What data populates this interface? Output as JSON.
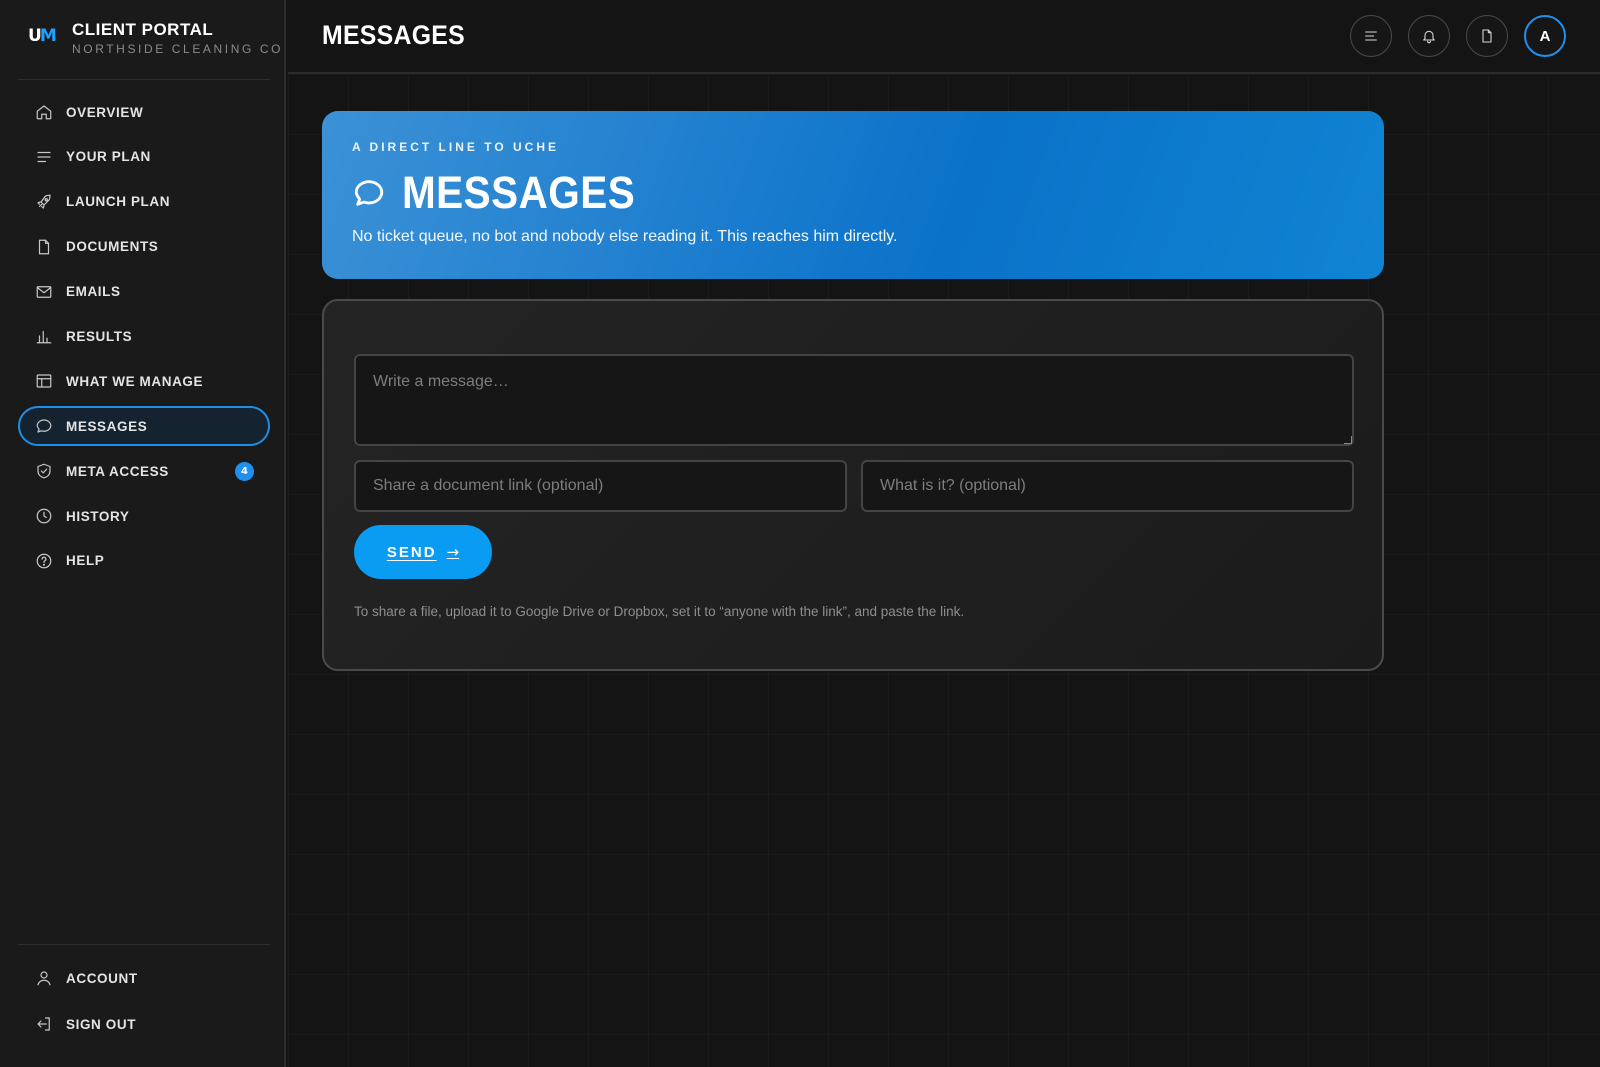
{
  "brand": {
    "logo_text": "UM",
    "title": "CLIENT PORTAL",
    "subtitle": "NORTHSIDE CLEANING CO"
  },
  "sidebar": {
    "items": [
      {
        "label": "OVERVIEW",
        "icon": "home-icon"
      },
      {
        "label": "YOUR PLAN",
        "icon": "list-icon"
      },
      {
        "label": "LAUNCH PLAN",
        "icon": "rocket-icon"
      },
      {
        "label": "DOCUMENTS",
        "icon": "document-icon"
      },
      {
        "label": "EMAILS",
        "icon": "mail-icon"
      },
      {
        "label": "RESULTS",
        "icon": "bar-chart-icon"
      },
      {
        "label": "WHAT WE MANAGE",
        "icon": "layout-icon"
      },
      {
        "label": "MESSAGES",
        "icon": "chat-icon",
        "active": true
      },
      {
        "label": "META ACCESS",
        "icon": "shield-icon",
        "badge": "4"
      },
      {
        "label": "HISTORY",
        "icon": "clock-icon"
      },
      {
        "label": "HELP",
        "icon": "help-icon"
      }
    ],
    "bottom": [
      {
        "label": "ACCOUNT",
        "icon": "user-icon"
      },
      {
        "label": "SIGN OUT",
        "icon": "sign-out-icon"
      }
    ]
  },
  "topbar": {
    "title": "MESSAGES",
    "actions": [
      "menu-icon",
      "bell-icon",
      "document-icon"
    ],
    "avatar_initial": "A"
  },
  "hero": {
    "kicker": "A DIRECT LINE TO UCHE",
    "title": "MESSAGES",
    "description": "No ticket queue, no bot and nobody else reading it. This reaches him directly."
  },
  "compose": {
    "message_placeholder": "Write a message…",
    "link_placeholder": "Share a document link (optional)",
    "what_placeholder": "What is it? (optional)",
    "send_label": "SEND",
    "send_arrow": "→",
    "hint": "To share a file, upload it to Google Drive or Dropbox, set it to “anyone with the link”, and paste the link."
  },
  "colors": {
    "accent": "#1e90ef",
    "background": "#141414",
    "sidebar": "#1a1a1a"
  }
}
